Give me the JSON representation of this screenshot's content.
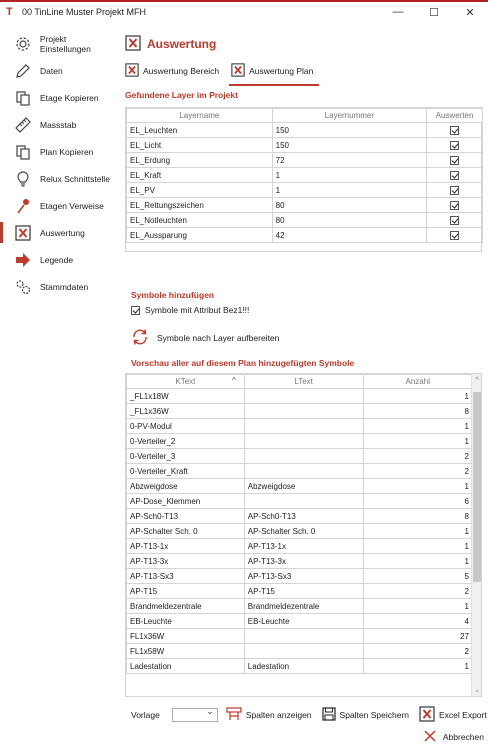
{
  "window": {
    "title": "00 TinLine Muster Projekt MFH",
    "logo": "T",
    "min_glyph": "—",
    "max_glyph": "☐",
    "close_glyph": "✕"
  },
  "sidebar": {
    "items": [
      {
        "label": "Projekt Einstellungen",
        "icon": "gear-icon"
      },
      {
        "label": "Daten",
        "icon": "pencil-icon"
      },
      {
        "label": "Etage Kopieren",
        "icon": "copy-icon"
      },
      {
        "label": "Massstab",
        "icon": "ruler-icon"
      },
      {
        "label": "Plan Kopieren",
        "icon": "copy-icon"
      },
      {
        "label": "Relux Schnittstelle",
        "icon": "bulb-icon"
      },
      {
        "label": "Etagen Verweise",
        "icon": "pin-icon"
      },
      {
        "label": "Auswertung",
        "icon": "excel-icon"
      },
      {
        "label": "Legende",
        "icon": "arrow-icon"
      },
      {
        "label": "Stammdaten",
        "icon": "gears-icon"
      }
    ],
    "active_index": 7
  },
  "main": {
    "title": "Auswertung",
    "tabs": [
      {
        "label": "Auswertung Bereich"
      },
      {
        "label": "Auswertung Plan"
      }
    ],
    "active_tab": 1
  },
  "layers": {
    "section_title": "Gefundene Layer im Projekt",
    "headers": [
      "Layername",
      "Layernummer",
      "Auswerten"
    ],
    "rows": [
      {
        "name": "EL_Leuchten",
        "number": "150",
        "checked": true
      },
      {
        "name": "EL_Licht",
        "number": "150",
        "checked": true
      },
      {
        "name": "EL_Erdung",
        "number": "72",
        "checked": true
      },
      {
        "name": "EL_Kraft",
        "number": "1",
        "checked": true
      },
      {
        "name": "EL_PV",
        "number": "1",
        "checked": true
      },
      {
        "name": "EL_Rettungszeichen",
        "number": "80",
        "checked": true
      },
      {
        "name": "EL_Notleuchten",
        "number": "80",
        "checked": true
      },
      {
        "name": "EL_Aussparung",
        "number": "42",
        "checked": true
      }
    ]
  },
  "symbols": {
    "section_title": "Symbole hinzufügen",
    "checkbox_label": "Symbole mit Attribut Bez1!!!",
    "refresh_label": "Symbole nach Layer aufbereiten"
  },
  "preview": {
    "section_title": "Vorschau aller auf diesem Plan hinzugefügten Symbole",
    "headers": [
      "KText",
      "LText",
      "Anzahl"
    ],
    "sort_glyph": "^",
    "rows": [
      {
        "k": "_FL1x18W",
        "l": "",
        "n": "1"
      },
      {
        "k": "_FL1x36W",
        "l": "",
        "n": "8"
      },
      {
        "k": "0-PV-Modul",
        "l": "",
        "n": "1"
      },
      {
        "k": "0-Verteiler_2",
        "l": "",
        "n": "1"
      },
      {
        "k": "0-Verteiler_3",
        "l": "",
        "n": "2"
      },
      {
        "k": "0-Verteiler_Kraft",
        "l": "",
        "n": "2"
      },
      {
        "k": "Abzweigdose",
        "l": "Abzweigdose",
        "n": "1"
      },
      {
        "k": "AP-Dose_Klemmen",
        "l": "",
        "n": "6"
      },
      {
        "k": "AP-Sch0-T13",
        "l": "AP-Sch0-T13",
        "n": "8"
      },
      {
        "k": "AP-Schalter Sch. 0",
        "l": "AP-Schalter Sch. 0",
        "n": "1"
      },
      {
        "k": "AP-T13-1x",
        "l": "AP-T13-1x",
        "n": "1"
      },
      {
        "k": "AP-T13-3x",
        "l": "AP-T13-3x",
        "n": "1"
      },
      {
        "k": "AP-T13-Sx3",
        "l": "AP-T13-Sx3",
        "n": "5"
      },
      {
        "k": "AP-T15",
        "l": "AP-T15",
        "n": "2"
      },
      {
        "k": "Brandmeldezentrale",
        "l": "Brandmeldezentrale",
        "n": "1"
      },
      {
        "k": "EB-Leuchte",
        "l": "EB-Leuchte",
        "n": "4"
      },
      {
        "k": "FL1x36W",
        "l": "",
        "n": "27"
      },
      {
        "k": "FL1x58W",
        "l": "",
        "n": "2"
      },
      {
        "k": "Ladestation",
        "l": "Ladestation",
        "n": "1"
      }
    ]
  },
  "bottom": {
    "vorlage_label": "Vorlage",
    "vorlage_value": "",
    "show_columns": "Spalten anzeigen",
    "save_columns": "Spalten Speichern",
    "excel_export": "Excel Export",
    "close": "Abbrechen"
  },
  "colors": {
    "accent": "#c0392b",
    "excel_green": "#217346"
  }
}
